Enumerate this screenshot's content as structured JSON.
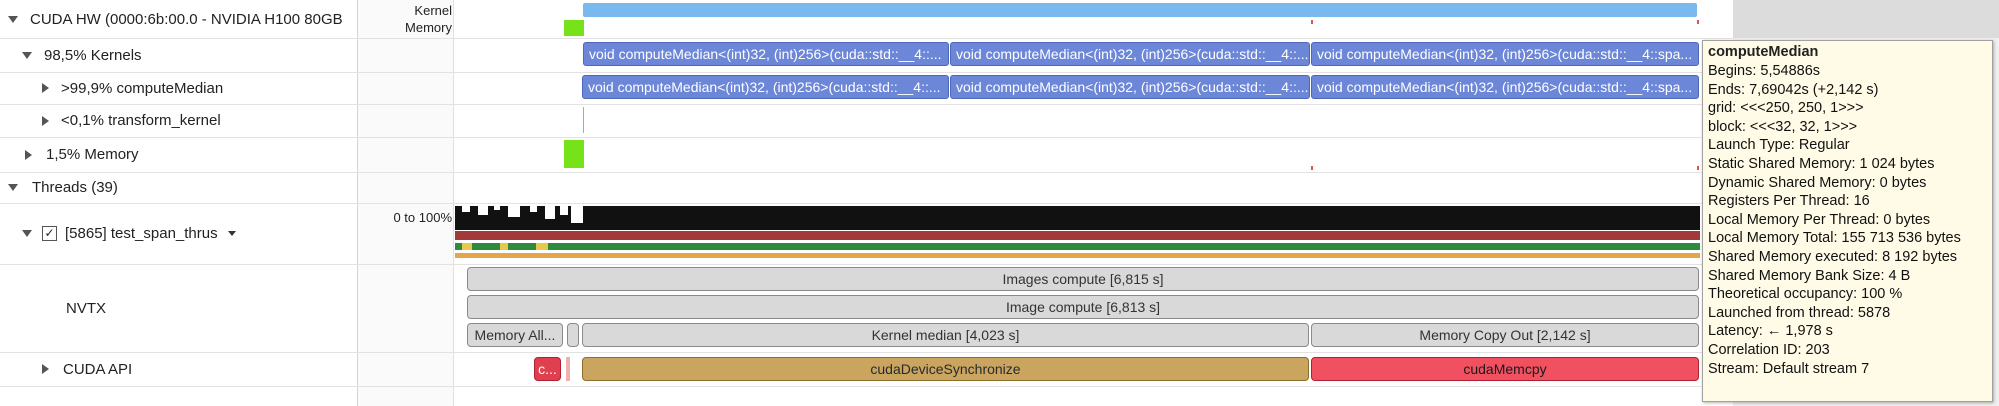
{
  "rows": {
    "cuda_hw": "CUDA HW (0000:6b:00.0 - NVIDIA H100 80GB",
    "cuda_hw_right_line1": "Kernel",
    "cuda_hw_right_line2": "Memory",
    "kernels": "98,5% Kernels",
    "compute_median": ">99,9% computeMedian",
    "transform_kernel": "<0,1% transform_kernel",
    "memory": "1,5% Memory",
    "threads": "Threads (39)",
    "thread_name": "[5865] test_span_thrus",
    "thread_range": "0 to 100%",
    "nvtx": "NVTX",
    "cuda_api": "CUDA API"
  },
  "kernel_row": [
    "void computeMedian<(int)32, (int)256>(cuda::std::__4::...",
    "void computeMedian<(int)32, (int)256>(cuda::std::__4::...",
    "void computeMedian<(int)32, (int)256>(cuda::std::__4::spa..."
  ],
  "median_row": [
    "void computeMedian<(int)32, (int)256>(cuda::std::__4::...",
    "void computeMedian<(int)32, (int)256>(cuda::std::__4::...",
    "void computeMedian<(int)32, (int)256>(cuda::std::__4::spa..."
  ],
  "nvtx": {
    "images_compute": "Images compute [6,815 s]",
    "image_compute": "Image compute [6,813 s]",
    "memory_alloc": "Memory All...",
    "kernel_median": "Kernel median [4,023 s]",
    "memory_copy_out": "Memory Copy Out [2,142 s]"
  },
  "cuda_api": {
    "small_call": "c...",
    "sync": "cudaDeviceSynchronize",
    "memcpy": "cudaMemcpy"
  },
  "tooltip": {
    "title": "computeMedian",
    "lines": [
      "Begins: 5,54886s",
      "Ends: 7,69042s (+2,142 s)",
      "grid:  <<<250, 250, 1>>>",
      "block: <<<32, 32, 1>>>",
      "Launch Type: Regular",
      "Static Shared Memory: 1 024 bytes",
      "Dynamic Shared Memory: 0 bytes",
      "Registers Per Thread: 16",
      "Local Memory Per Thread: 0 bytes",
      "Local Memory Total: 155 713 536 bytes",
      "Shared Memory executed: 8 192 bytes",
      "Shared Memory Bank Size: 4 B",
      "Theoretical occupancy: 100 %",
      "Launched from thread: 5878",
      "Latency: ✵2← 1,978 s",
      "Correlation ID: 203",
      "Stream: Default stream 7"
    ]
  },
  "colors": {
    "kernel_blue": "#6c86d8",
    "top_bar": "#79b9ee",
    "memory_green": "#76e21a",
    "api_sync": "#c9a55f",
    "api_memcpy": "#f05060",
    "thread_red": "#a33a3a",
    "thread_green": "#2e8b3e",
    "thread_orange": "#e7a54a"
  }
}
